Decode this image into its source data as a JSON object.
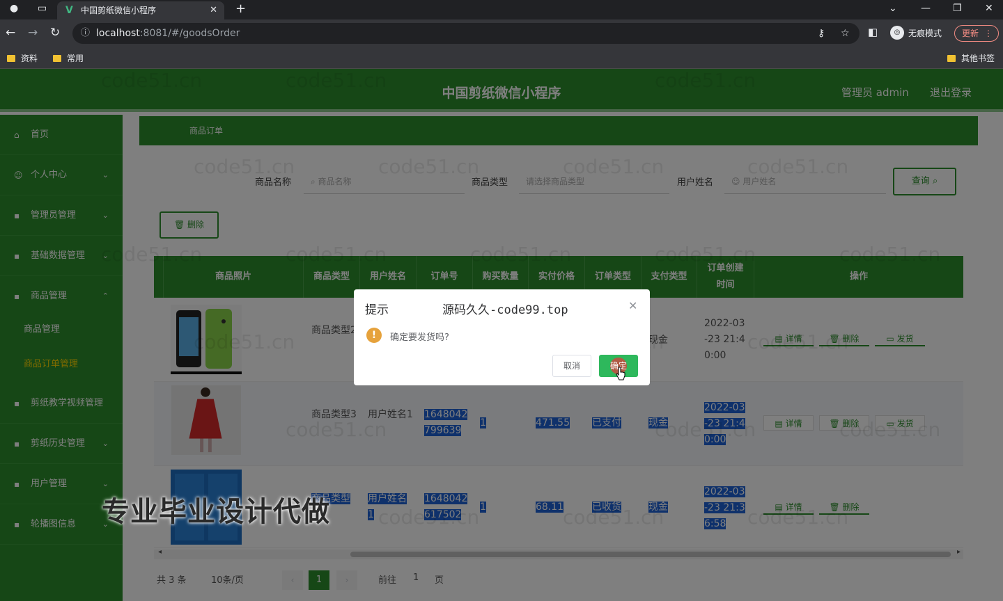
{
  "browser": {
    "tab_title": "中国剪纸微信小程序",
    "url_host": "localhost",
    "url_path": ":8081/#/goodsOrder",
    "incognito_label": "无痕模式",
    "update_label": "更新",
    "bookmarks": [
      "资料",
      "常用"
    ],
    "other_bookmarks": "其他书签"
  },
  "header": {
    "title": "中国剪纸微信小程序",
    "user": "管理员 admin",
    "logout": "退出登录"
  },
  "sidebar": {
    "items": [
      "首页",
      "个人中心",
      "管理员管理",
      "基础数据管理",
      "商品管理"
    ],
    "sub_items": [
      "商品管理",
      "商品订单管理"
    ],
    "items2": [
      "剪纸教学视频管理",
      "剪纸历史管理",
      "用户管理",
      "轮播图信息"
    ]
  },
  "breadcrumb": "商品订单",
  "filters": {
    "name_label": "商品名称",
    "name_placeholder": "商品名称",
    "type_label": "商品类型",
    "type_placeholder": "请选择商品类型",
    "user_label": "用户姓名",
    "user_placeholder": "用户姓名",
    "query_label": "查询"
  },
  "delete_label": "删除",
  "table": {
    "headers": [
      "商品照片",
      "商品类型",
      "用户姓名",
      "订单号",
      "购买数量",
      "实付价格",
      "订单类型",
      "支付类型",
      "订单创建时间",
      "操作"
    ],
    "rows": [
      {
        "type": "商品类型2",
        "user": "",
        "order": "",
        "qty": "",
        "price": "",
        "status": "",
        "pay": "现金",
        "time": [
          "2022-03",
          "-23 21:4",
          "0:00"
        ],
        "ops": [
          "详情",
          "删除",
          "发货"
        ]
      },
      {
        "type": "商品类型3",
        "user": "用户姓名1",
        "order": [
          "1648042",
          "799639"
        ],
        "qty": "1",
        "price": "471.55",
        "status": "已支付",
        "pay": "现金",
        "time": [
          "2022-03",
          "-23 21:4",
          "0:00"
        ],
        "ops": [
          "详情",
          "删除",
          "发货"
        ]
      },
      {
        "type": "商品类型",
        "user": "用户姓名1",
        "order": [
          "1648042",
          "617502"
        ],
        "qty": "1",
        "price": "68.11",
        "status": "已收货",
        "pay": "现金",
        "time": [
          "2022-03",
          "-23 21:3",
          "6:58"
        ],
        "ops": [
          "详情",
          "删除"
        ]
      }
    ]
  },
  "pagination": {
    "total": "共 3 条",
    "page_size": "10条/页",
    "current": "1",
    "goto": "前往",
    "goto_value": "1",
    "page_unit": "页"
  },
  "dialog": {
    "title": "提示",
    "source": "源码久久-code99.top",
    "message": "确定要发货吗?",
    "cancel": "取消",
    "confirm": "确定"
  },
  "watermark": "code51.cn",
  "caption": "专业毕业设计代做"
}
